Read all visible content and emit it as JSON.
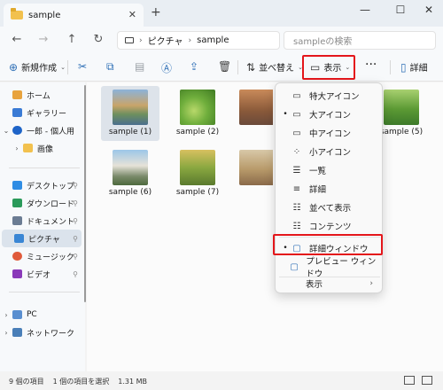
{
  "tab": {
    "title": "sample",
    "close": "✕",
    "new": "+"
  },
  "window": {
    "minimize": "—",
    "maximize": "☐",
    "close": "✕"
  },
  "nav": {
    "back": "←",
    "forward": "→",
    "up": "↑",
    "refresh": "↻",
    "path_sep": "›",
    "path": [
      "ピクチャ",
      "sample"
    ],
    "search_placeholder": "sampleの検索"
  },
  "toolbar": {
    "new_label": "新規作成",
    "sort_label": "並べ替え",
    "view_label": "表示",
    "more_label": "···",
    "details_label": "詳細"
  },
  "sidebar": {
    "items": [
      {
        "label": "ホーム",
        "icon": "home-icon"
      },
      {
        "label": "ギャラリー",
        "icon": "gallery-icon"
      },
      {
        "label": "一郎 - 個人用",
        "icon": "cloud-icon"
      },
      {
        "label": "画像",
        "icon": "folder-icon"
      },
      {
        "label": "デスクトップ",
        "icon": "desktop-icon"
      },
      {
        "label": "ダウンロード",
        "icon": "download-icon"
      },
      {
        "label": "ドキュメント",
        "icon": "document-icon"
      },
      {
        "label": "ピクチャ",
        "icon": "pictures-icon"
      },
      {
        "label": "ミュージック",
        "icon": "music-icon"
      },
      {
        "label": "ビデオ",
        "icon": "video-icon"
      },
      {
        "label": "PC",
        "icon": "pc-icon"
      },
      {
        "label": "ネットワーク",
        "icon": "network-icon"
      }
    ]
  },
  "files": [
    {
      "name": "sample (1)"
    },
    {
      "name": "sample (2)"
    },
    {
      "name": "sample (5)"
    },
    {
      "name": "sample (6)"
    },
    {
      "name": "sample (7)"
    }
  ],
  "view_menu": {
    "items": [
      {
        "label": "特大アイコン",
        "icon": "▭",
        "selected": false
      },
      {
        "label": "大アイコン",
        "icon": "▭",
        "selected": true
      },
      {
        "label": "中アイコン",
        "icon": "▭",
        "selected": false
      },
      {
        "label": "小アイコン",
        "icon": "⁘",
        "selected": false
      },
      {
        "label": "一覧",
        "icon": "☰",
        "selected": false
      },
      {
        "label": "詳細",
        "icon": "≡",
        "selected": false
      },
      {
        "label": "並べて表示",
        "icon": "☷",
        "selected": false
      },
      {
        "label": "コンテンツ",
        "icon": "☷",
        "selected": false
      },
      {
        "label": "詳細ウィンドウ",
        "icon": "▢",
        "selected": true
      },
      {
        "label": "プレビュー ウィンドウ",
        "icon": "▢",
        "selected": false
      },
      {
        "label": "表示",
        "icon": "",
        "selected": false
      }
    ],
    "bullet": "•",
    "submenu_arrow": "›"
  },
  "status": {
    "count": "9 個の項目",
    "selection": "1 個の項目を選択",
    "size": "1.31 MB"
  },
  "colors": {
    "accent": "#2e6fb6",
    "highlight_box": "#e4161b",
    "selection": "#dde3ea"
  }
}
